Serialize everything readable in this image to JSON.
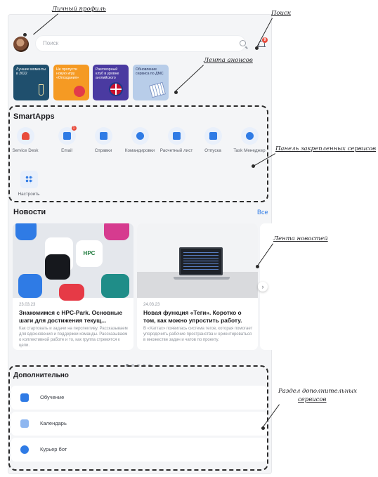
{
  "header": {
    "search_placeholder": "Поиск",
    "notification_count": "9"
  },
  "stories": [
    {
      "label": "Лучшие моменты в 2022"
    },
    {
      "label": "Не пропусти новую игру «Опоздания»"
    },
    {
      "label": "Разговорный клуб в уровне английского"
    },
    {
      "label": "Обновление сервиса по ДМС"
    }
  ],
  "smartapps": {
    "title": "SmartApps",
    "items": [
      {
        "label": "Service Desk"
      },
      {
        "label": "Email",
        "badge": "1"
      },
      {
        "label": "Справки"
      },
      {
        "label": "Командировки"
      },
      {
        "label": "Расчетный лист"
      },
      {
        "label": "Отпуска"
      },
      {
        "label": "Task Менеджер"
      },
      {
        "label": "Настроить"
      }
    ]
  },
  "news": {
    "title": "Новости",
    "all_link": "Все",
    "cards": [
      {
        "date": "23.03.23",
        "title": "Знакомимся с HPC-Park. Основные шаги для достижения текущ...",
        "text": "Как стартовать и задачи на перспективу. Рассказываем для вдохновения и поддержки команды. Рассказываем о коллективной работе и то, как группа стремятся к цели."
      },
      {
        "date": "24.03.23",
        "title": "Новая функция «Теги». Коротко о том, как можно упростить работу.",
        "text": "В «Хаттах» появилась система тегов, которая помогает упорядочить рабочие пространства и ориентироваться в множестве задач и чатов по проекту."
      }
    ]
  },
  "extra": {
    "title": "Дополнительно",
    "items": [
      {
        "label": "Обучение"
      },
      {
        "label": "Календарь"
      },
      {
        "label": "Курьер бот"
      }
    ]
  },
  "annotations": {
    "profile": "Личный профиль",
    "search": "Поиск",
    "stories": "Лента анонсов",
    "services_panel": "Панель закрепленных сервисов",
    "news_feed": "Лента новостей",
    "extra_section_line1": "Раздел дополнительных",
    "extra_section_line2": "сервисов"
  },
  "colors": {
    "accent": "#2f7be5",
    "badge": "#e84b3c",
    "background": "#f4f5f7"
  }
}
